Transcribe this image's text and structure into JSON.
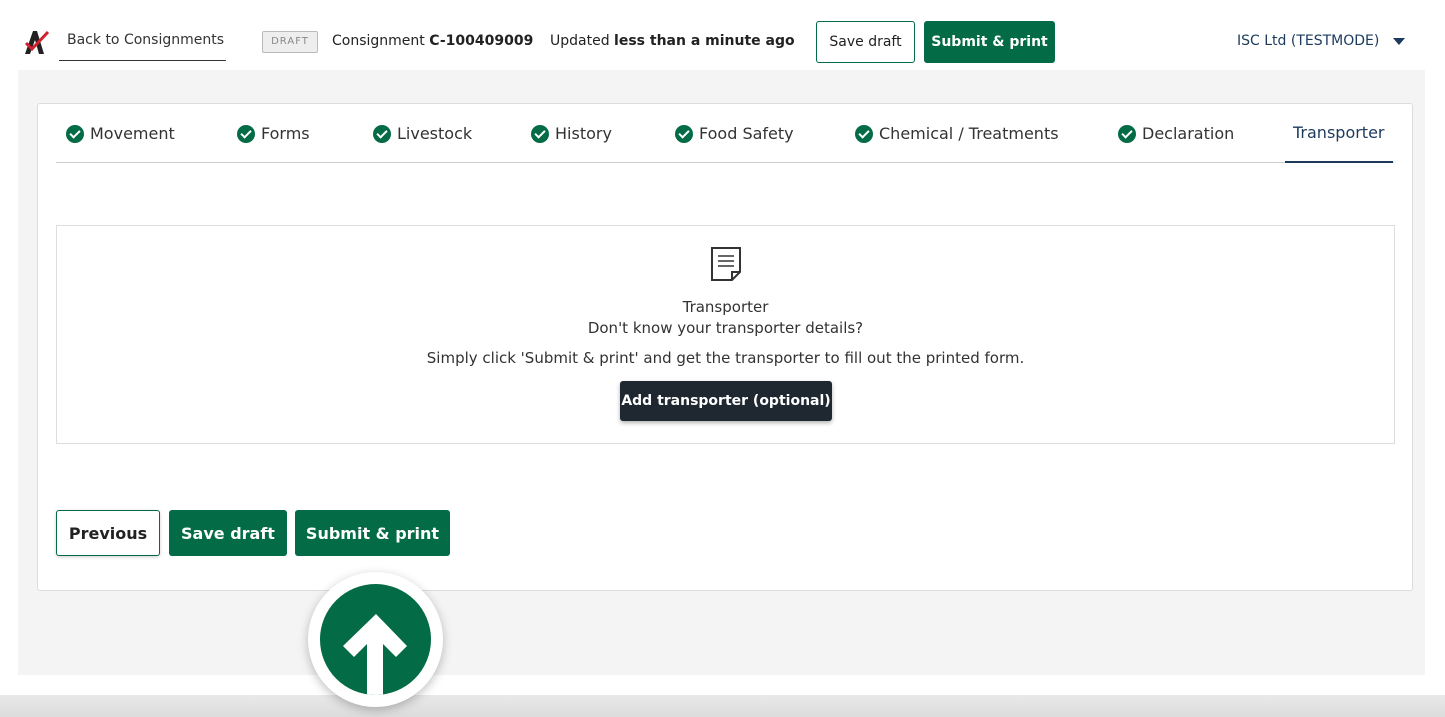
{
  "header": {
    "back_label": "Back to Consignments",
    "status_badge": "DRAFT",
    "consignment_prefix": "Consignment",
    "consignment_id": "C-100409009",
    "updated_prefix": "Updated",
    "updated_value": "less than a minute ago",
    "save_draft": "Save draft",
    "submit_print": "Submit & print",
    "org": "ISC Ltd (TESTMODE)"
  },
  "tabs": [
    {
      "label": "Movement",
      "complete": true
    },
    {
      "label": "Forms",
      "complete": true
    },
    {
      "label": "Livestock",
      "complete": true
    },
    {
      "label": "History",
      "complete": true
    },
    {
      "label": "Food Safety",
      "complete": true
    },
    {
      "label": "Chemical / Treatments",
      "complete": true
    },
    {
      "label": "Declaration",
      "complete": true
    },
    {
      "label": "Transporter",
      "complete": false,
      "active": true
    }
  ],
  "transporter": {
    "icon": "document-icon",
    "title": "Transporter",
    "subtitle": "Don't know your transporter details?",
    "hint": "Simply click 'Submit & print' and get the transporter to fill out the printed form.",
    "add_button": "Add transporter (optional)"
  },
  "footer": {
    "previous": "Previous",
    "save_draft": "Save draft",
    "submit_print": "Submit & print"
  },
  "overlay": {
    "icon": "arrow-up-icon"
  },
  "colors": {
    "accent": "#036b45",
    "dark": "#1f2830",
    "nav": "#1b3a5c"
  }
}
